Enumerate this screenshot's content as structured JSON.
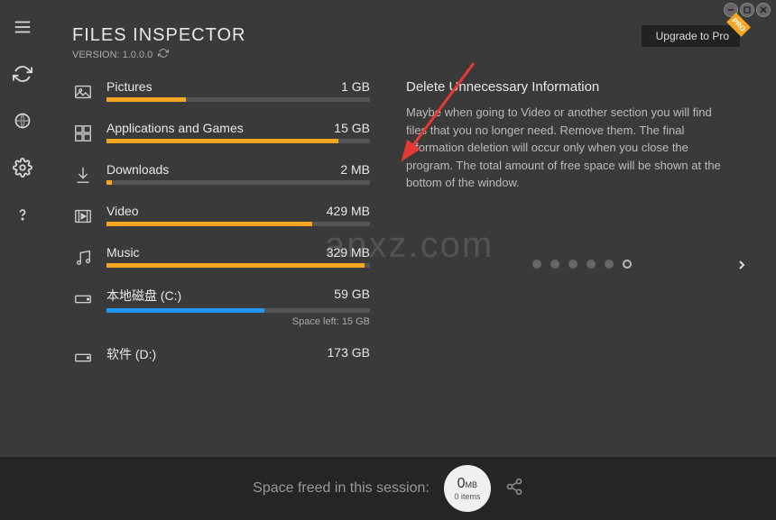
{
  "app": {
    "title": "FILES INSPECTOR",
    "version_label": "VERSION: 1.0.0.0",
    "upgrade_label": "Upgrade to Pro",
    "pro_badge": "PRO"
  },
  "categories": [
    {
      "id": "pictures",
      "label": "Pictures",
      "size": "1 GB",
      "fill_pct": 30,
      "color": "#f5a623"
    },
    {
      "id": "apps-games",
      "label": "Applications and Games",
      "size": "15 GB",
      "fill_pct": 88,
      "color": "#f5a623"
    },
    {
      "id": "downloads",
      "label": "Downloads",
      "size": "2 MB",
      "fill_pct": 2,
      "color": "#f5a623"
    },
    {
      "id": "video",
      "label": "Video",
      "size": "429 MB",
      "fill_pct": 78,
      "color": "#f5a623"
    },
    {
      "id": "music",
      "label": "Music",
      "size": "329 MB",
      "fill_pct": 98,
      "color": "#f5a623"
    },
    {
      "id": "disk-c",
      "label": "本地磁盘 (C:)",
      "size": "59 GB",
      "fill_pct": 60,
      "color": "#2196f3",
      "sub": "Space left: 15 GB"
    },
    {
      "id": "disk-d",
      "label": "软件 (D:)",
      "size": "173 GB",
      "fill_pct": 0,
      "color": "#2196f3"
    }
  ],
  "info": {
    "title": "Delete Unnecessary Information",
    "body": "Maybe when going to Video or another section you will find files that you no longer need. Remove them. The final information deletion will occur only when you close the program. The total amount of free space will be shown at the bottom of the window."
  },
  "pagination": {
    "total": 6,
    "active_index": 5
  },
  "footer": {
    "label": "Space freed in this session:",
    "amount": "0",
    "unit": "MB",
    "items": "0 items"
  },
  "watermark": "anxz.com"
}
